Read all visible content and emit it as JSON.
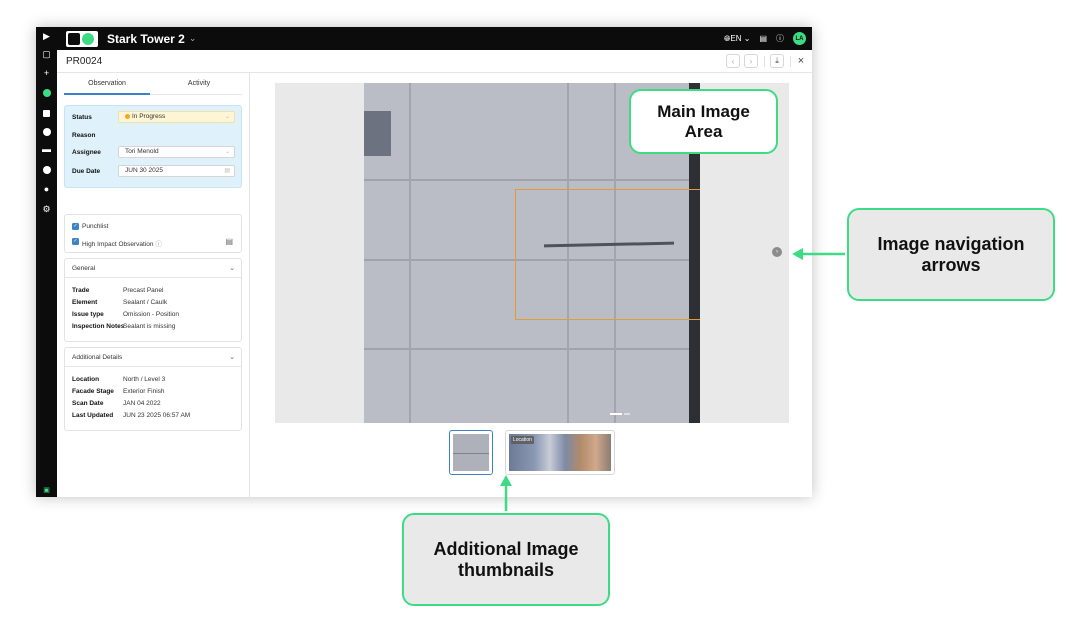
{
  "header": {
    "project_name": "Stark Tower 2",
    "language": "EN",
    "avatar_initials": "LA",
    "record_id": "PR0024"
  },
  "tabs": [
    "Observation",
    "Activity"
  ],
  "status_card": {
    "status_label": "Status",
    "status_value": "In Progress",
    "reason_label": "Reason",
    "assignee_label": "Assignee",
    "assignee_value": "Tori Menold",
    "due_date_label": "Due Date",
    "due_date_value": "JUN 30 2025"
  },
  "flags": {
    "punchlist": "Punchlist",
    "high_impact": "High Impact Observation"
  },
  "general": {
    "title": "General",
    "rows": [
      {
        "label": "Trade",
        "value": "Precast Panel"
      },
      {
        "label": "Element",
        "value": "Sealant / Caulk"
      },
      {
        "label": "Issue type",
        "value": "Omission - Position"
      },
      {
        "label": "Inspection Notes",
        "value": "Sealant is missing"
      }
    ]
  },
  "additional": {
    "title": "Additional Details",
    "rows": [
      {
        "label": "Location",
        "value": "North / Level 3"
      },
      {
        "label": "Facade Stage",
        "value": "Exterior Finish"
      },
      {
        "label": "Scan Date",
        "value": "JAN 04 2022"
      },
      {
        "label": "Last Updated",
        "value": "JUN 23 2025 06:57 AM"
      }
    ]
  },
  "thumbnails": {
    "location_badge": "Location"
  },
  "callouts": {
    "main_image": "Main Image Area",
    "navigation": "Image navigation arrows",
    "thumbnails": "Additional Image thumbnails"
  },
  "colors": {
    "accent": "#3ddc84",
    "primary": "#3b82c6",
    "status_in_progress": "#f5a623",
    "roi_box": "#e29b3c"
  }
}
